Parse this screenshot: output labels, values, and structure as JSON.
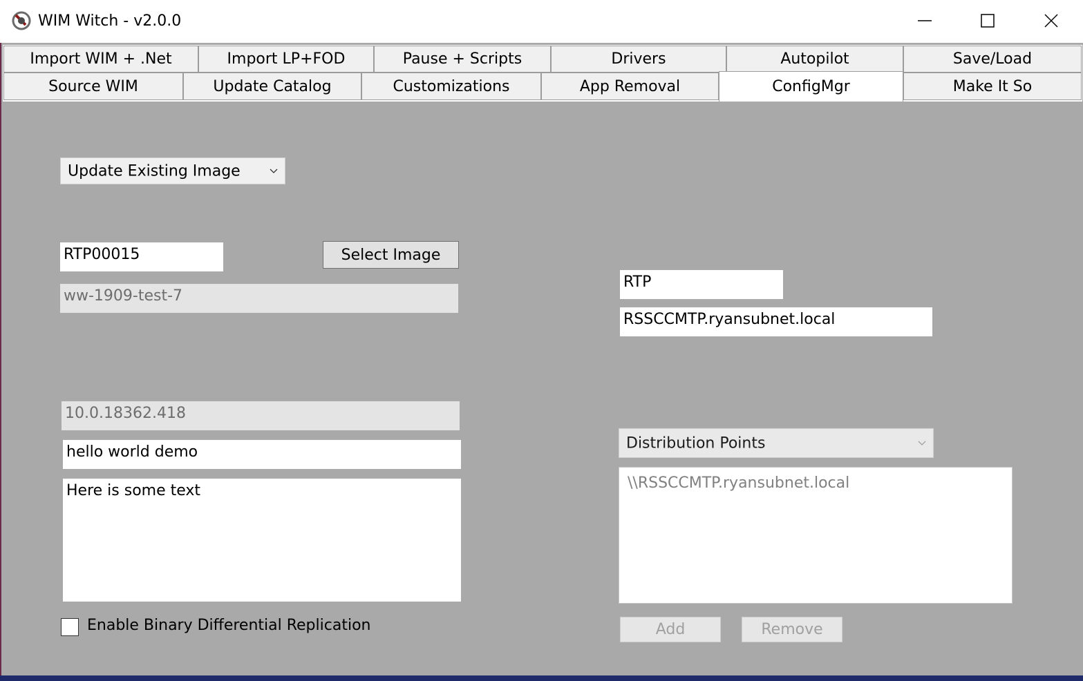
{
  "window": {
    "title": "WIM Witch - v2.0.0",
    "icon": "wim-witch-app-icon",
    "controls": [
      "minimize-icon",
      "maximize-icon",
      "close-icon"
    ]
  },
  "tabs": {
    "row1": [
      "Import WIM + .Net",
      "Import LP+FOD",
      "Pause + Scripts",
      "Drivers",
      "Autopilot",
      "Save/Load"
    ],
    "row2": [
      "Source WIM",
      "Update Catalog",
      "Customizations",
      "App Removal",
      "ConfigMgr",
      "Make It So"
    ],
    "active": "ConfigMgr"
  },
  "configmgr": {
    "image_type_selected": "Update Existing Image",
    "package_id": "RTP00015",
    "select_image_label": "Select Image",
    "image_name": "ww-1909-test-7",
    "site_code": "RTP",
    "site_server": "RSSCCMTP.ryansubnet.local",
    "version": "10.0.18362.418",
    "image_description_short": "hello world demo",
    "image_description_long": "Here is some text",
    "binary_diff_replication_label": "Enable Binary Differential Replication",
    "binary_diff_replication_checked": false,
    "dp_type_selected": "Distribution Points",
    "dp_list": [
      "\\\\RSSCCMTP.ryansubnet.local"
    ],
    "add_label": "Add",
    "remove_label": "Remove"
  }
}
